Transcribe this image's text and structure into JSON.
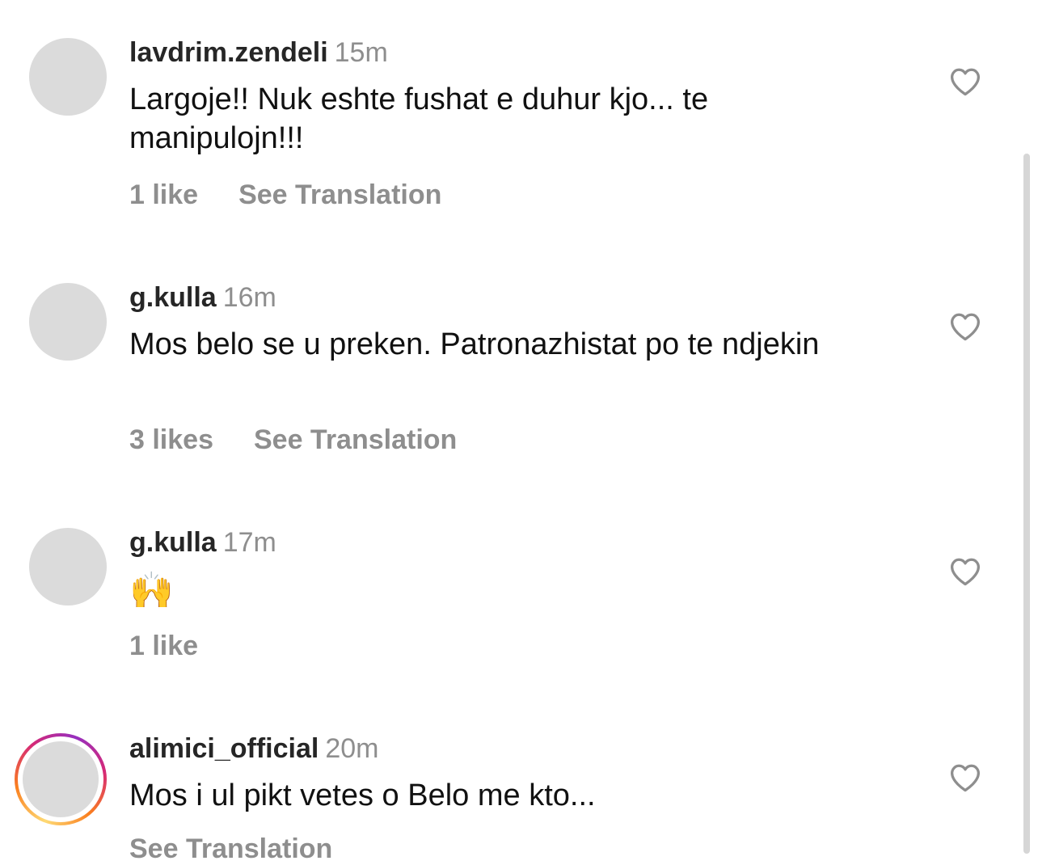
{
  "comments": [
    {
      "username": "lavdrim.zendeli",
      "time": "15m",
      "text": "Largoje!! Nuk eshte fushat e duhur kjo... te manipulojn!!!",
      "likes": "1 like",
      "translation": "See Translation"
    },
    {
      "username": "g.kulla",
      "time": "16m",
      "text": "Mos belo se u preken. Patronazhistat po te ndjekin",
      "likes": "3 likes",
      "translation": "See Translation"
    },
    {
      "username": "g.kulla",
      "time": "17m",
      "text": "🙌",
      "likes": "1 like"
    },
    {
      "username": "alimici_official",
      "time": "20m",
      "text": "Mos i ul pikt vetes o Belo me kto...",
      "translation": "See Translation",
      "has_story_ring": true
    }
  ],
  "icons": {
    "like": "heart-outline-icon"
  },
  "colors": {
    "username": "#262626",
    "secondary_text": "#8e8e8e",
    "avatar_placeholder": "#dbdbdb",
    "story_ring": [
      "#feda75",
      "#fa7e1e",
      "#d62976",
      "#962fbf"
    ]
  }
}
